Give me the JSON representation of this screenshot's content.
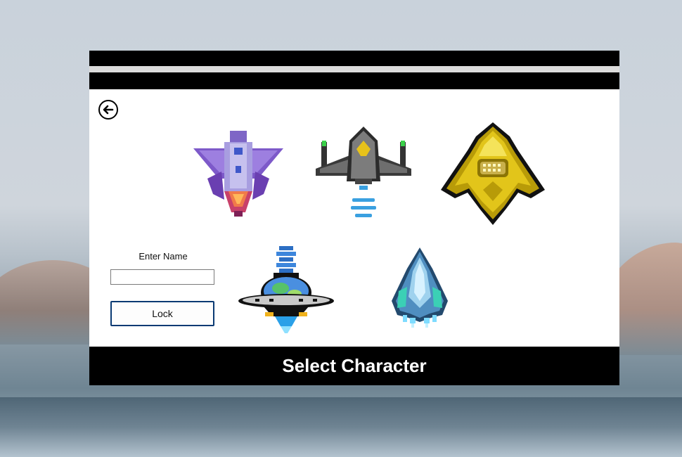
{
  "window": {
    "title": ""
  },
  "back": {
    "icon": "back-arrow-icon"
  },
  "ships": [
    {
      "id": "purple-fighter",
      "icon": "purple-jet-ship-icon"
    },
    {
      "id": "gray-fighter",
      "icon": "gray-jet-ship-icon"
    },
    {
      "id": "gold-ship",
      "icon": "gold-ship-icon"
    },
    {
      "id": "ufo",
      "icon": "ufo-ship-icon"
    },
    {
      "id": "blue-fighter",
      "icon": "blue-crystal-ship-icon"
    }
  ],
  "name_form": {
    "label": "Enter Name",
    "value": "",
    "placeholder": ""
  },
  "lock_button": {
    "label": "Lock"
  },
  "footer": {
    "title": "Select Character"
  },
  "colors": {
    "window_bg": "#ffffff",
    "bars": "#000000",
    "lock_border": "#0a3a73"
  }
}
